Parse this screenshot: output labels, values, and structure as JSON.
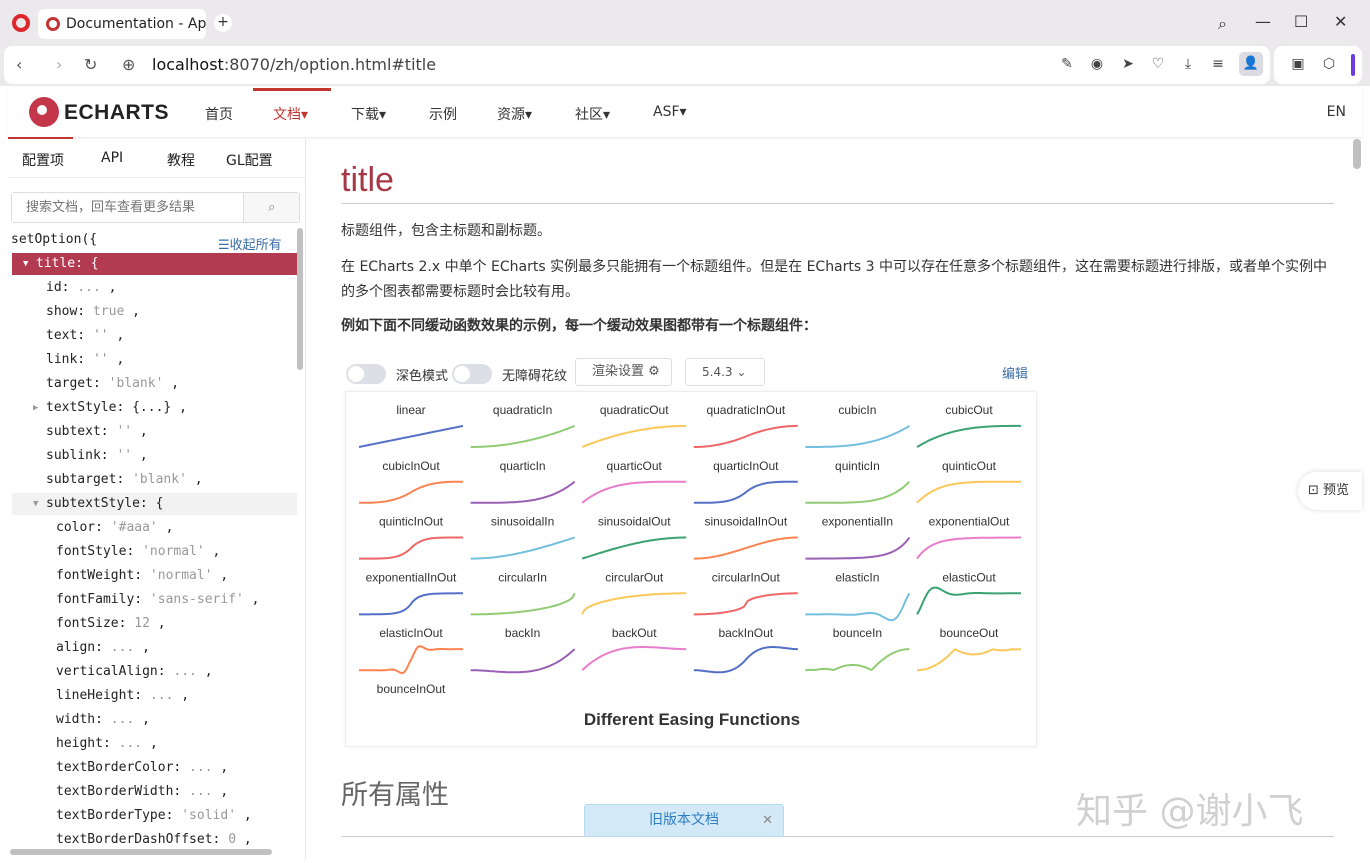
{
  "browser": {
    "tab_title": "Documentation - Ap",
    "url_host": "localhost",
    "url_rest": ":8070/zh/option.html#title"
  },
  "header": {
    "logo": "ECHARTS",
    "nav": [
      "首页",
      "文档▾",
      "下载▾",
      "示例",
      "资源▾",
      "社区▾",
      "ASF▾"
    ],
    "lang": "EN"
  },
  "sidebar": {
    "tabs": [
      "配置项",
      "API",
      "教程",
      "GL配置"
    ],
    "search_placeholder": "搜索文档，回车查看更多结果",
    "root": "setOption({",
    "collapse_all": "☰收起所有",
    "rows": [
      {
        "text": "title: {",
        "sel": true,
        "arrow": "▼",
        "indent": 0
      },
      {
        "key": "id",
        "dots": " ... ",
        "tail": ",",
        "indent": 1
      },
      {
        "key": "show",
        "val": "true",
        "tail": " ,",
        "indent": 1
      },
      {
        "key": "text",
        "val": "''",
        "tail": " ,",
        "indent": 1
      },
      {
        "key": "link",
        "val": "''",
        "tail": " ,",
        "indent": 1
      },
      {
        "key": "target",
        "val": "'blank'",
        "tail": " ,",
        "indent": 1
      },
      {
        "key": "textStyle",
        "plain": "{...}",
        "tail": " ,",
        "indent": 1,
        "arrow": "▶"
      },
      {
        "key": "subtext",
        "val": "''",
        "tail": " ,",
        "indent": 1
      },
      {
        "key": "sublink",
        "val": "''",
        "tail": " ,",
        "indent": 1
      },
      {
        "key": "subtarget",
        "val": "'blank'",
        "tail": " ,",
        "indent": 1
      },
      {
        "text": "subtextStyle: {",
        "hl": true,
        "arrow": "▼",
        "indent": 1
      },
      {
        "key": "color",
        "val": "'#aaa'",
        "tail": " ,",
        "indent": 2
      },
      {
        "key": "fontStyle",
        "val": "'normal'",
        "tail": " ,",
        "indent": 2
      },
      {
        "key": "fontWeight",
        "val": "'normal'",
        "tail": " ,",
        "indent": 2
      },
      {
        "key": "fontFamily",
        "val": "'sans-serif'",
        "tail": " ,",
        "indent": 2
      },
      {
        "key": "fontSize",
        "val": "12",
        "tail": " ,",
        "indent": 2
      },
      {
        "key": "align",
        "dots": " ... ",
        "tail": ",",
        "indent": 2
      },
      {
        "key": "verticalAlign",
        "dots": " ... ",
        "tail": ",",
        "indent": 2
      },
      {
        "key": "lineHeight",
        "dots": " ... ",
        "tail": ",",
        "indent": 2
      },
      {
        "key": "width",
        "dots": " ... ",
        "tail": ",",
        "indent": 2
      },
      {
        "key": "height",
        "dots": " ... ",
        "tail": ",",
        "indent": 2
      },
      {
        "key": "textBorderColor",
        "dots": " ... ",
        "tail": ",",
        "indent": 2
      },
      {
        "key": "textBorderWidth",
        "dots": " ... ",
        "tail": ",",
        "indent": 2
      },
      {
        "key": "textBorderType",
        "val": "'solid'",
        "tail": " ,",
        "indent": 2
      },
      {
        "key": "textBorderDashOffset",
        "val": "0",
        "tail": " ,",
        "indent": 2
      }
    ]
  },
  "main": {
    "title": "title",
    "p1": "标题组件，包含主标题和副标题。",
    "p2": "在 ECharts 2.x 中单个 ECharts 实例最多只能拥有一个标题组件。但是在 ECharts 3 中可以存在任意多个标题组件，这在需要标题进行排版，或者单个实例中的多个图表都需要标题时会比较有用。",
    "p3": "例如下面不同缓动函数效果的示例，每一个缓动效果图都带有一个标题组件：",
    "dark_mode": "深色模式",
    "aria_mode": "无障碍花纹",
    "render_settings": "渲染设置 ⚙",
    "version": "5.4.3 ⌄",
    "edit": "编辑",
    "section2": "所有属性",
    "old_docs": "旧版本文档",
    "preview": "预览",
    "watermark": "知乎 @谢小飞"
  },
  "chart_data": {
    "type": "line",
    "title": "Different Easing Functions",
    "series": [
      {
        "name": "linear",
        "color": "#5470c6"
      },
      {
        "name": "quadraticIn",
        "color": "#91cc75"
      },
      {
        "name": "quadraticOut",
        "color": "#fac858"
      },
      {
        "name": "quadraticInOut",
        "color": "#ee6666"
      },
      {
        "name": "cubicIn",
        "color": "#73c0de"
      },
      {
        "name": "cubicOut",
        "color": "#3ba272"
      },
      {
        "name": "cubicInOut",
        "color": "#fc8452"
      },
      {
        "name": "quarticIn",
        "color": "#9a60b4"
      },
      {
        "name": "quarticOut",
        "color": "#ea7ccc"
      },
      {
        "name": "quarticInOut",
        "color": "#5470c6"
      },
      {
        "name": "quinticIn",
        "color": "#91cc75"
      },
      {
        "name": "quinticOut",
        "color": "#fac858"
      },
      {
        "name": "quinticInOut",
        "color": "#ee6666"
      },
      {
        "name": "sinusoidalIn",
        "color": "#73c0de"
      },
      {
        "name": "sinusoidalOut",
        "color": "#3ba272"
      },
      {
        "name": "sinusoidalInOut",
        "color": "#fc8452"
      },
      {
        "name": "exponentialIn",
        "color": "#9a60b4"
      },
      {
        "name": "exponentialOut",
        "color": "#ea7ccc"
      },
      {
        "name": "exponentialInOut",
        "color": "#5470c6"
      },
      {
        "name": "circularIn",
        "color": "#91cc75"
      },
      {
        "name": "circularOut",
        "color": "#fac858"
      },
      {
        "name": "circularInOut",
        "color": "#ee6666"
      },
      {
        "name": "elasticIn",
        "color": "#73c0de"
      },
      {
        "name": "elasticOut",
        "color": "#3ba272"
      },
      {
        "name": "elasticInOut",
        "color": "#fc8452"
      },
      {
        "name": "backIn",
        "color": "#9a60b4"
      },
      {
        "name": "backOut",
        "color": "#ea7ccc"
      },
      {
        "name": "backInOut",
        "color": "#5470c6"
      },
      {
        "name": "bounceIn",
        "color": "#91cc75"
      },
      {
        "name": "bounceOut",
        "color": "#fac858"
      },
      {
        "name": "bounceInOut",
        "color": "#ee6666"
      }
    ],
    "x": [
      0,
      1
    ],
    "ylim": [
      0,
      1
    ]
  }
}
